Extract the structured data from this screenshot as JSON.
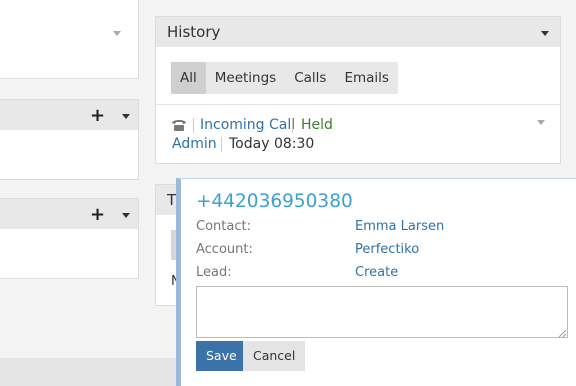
{
  "history": {
    "title": "History",
    "tabs": [
      "All",
      "Meetings",
      "Calls",
      "Emails"
    ],
    "entry": {
      "type_label": "Incoming Call",
      "status": "Held",
      "user": "Admin",
      "time": "Today 08:30"
    }
  },
  "partial_panel": {
    "title_fragment": "T",
    "body_fragment": "N"
  },
  "popup": {
    "phone": "+442036950380",
    "contact_label": "Contact:",
    "contact_value": "Emma Larsen",
    "account_label": "Account:",
    "account_value": "Perfectiko",
    "lead_label": "Lead:",
    "lead_value": "Create",
    "notes_value": "",
    "save_label": "Save",
    "cancel_label": "Cancel"
  },
  "colors": {
    "link": "#2f72a8",
    "phone": "#3ba0d3",
    "status_held": "#3a7d2e",
    "save_button": "#3b73a8"
  },
  "icons": {
    "plus": "+",
    "phone": "phone-icon",
    "caret": "chevron-down-icon"
  }
}
